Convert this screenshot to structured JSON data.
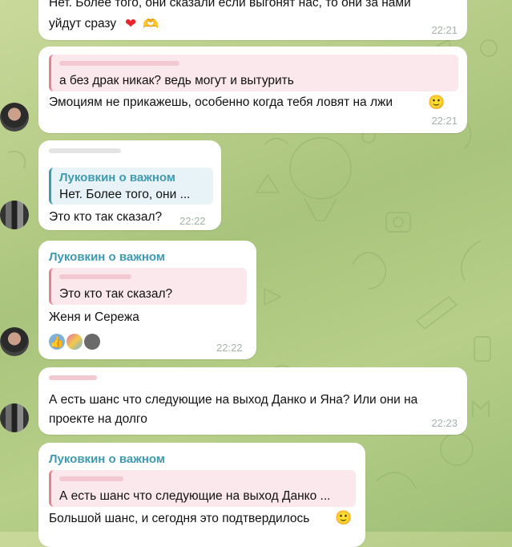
{
  "messages": [
    {
      "text_line1": "Нет. Более того, они сказали если выгонят нас, то они за нами",
      "text_line2": "уйдут сразу",
      "emoji": [
        "heart-icon",
        "heart-hands-icon"
      ],
      "time": "22:21"
    },
    {
      "quote_text": "а без драк никак?  ведь могут и вытурить",
      "text": "Эмоциям не прикажешь, особенно когда тебя ловят на лжи",
      "emoji": "slightly-smiling-face-icon",
      "time": "22:21"
    },
    {
      "quote_name": "Луковкин о важном",
      "quote_text": "Нет. Более того, они ...",
      "text": "Это кто так сказал?",
      "time": "22:22"
    },
    {
      "sender": "Луковкин о важном",
      "quote_text": "Это кто так сказал?",
      "text": "Женя и Сережа",
      "reactions": [
        "thumbs-up-icon",
        "reactor-avatar-icon",
        "reactor-avatar-icon"
      ],
      "time": "22:22"
    },
    {
      "text_line1": "А есть шанс что следующие на выход Данко и Яна? Или они на",
      "text_line2": "проекте на долго",
      "time": "22:23"
    },
    {
      "sender": "Луковкин о важном",
      "quote_text": "А есть шанс что следующие на выход Данко ...",
      "text": "Большой шанс, и сегодня это подтвердилось",
      "emoji": "slightly-smiling-face-icon"
    }
  ],
  "colors": {
    "sender_name": "#3f9ab0",
    "quote_pink": "#e4838f",
    "bubble": "#ffffff",
    "time": "#a3b3a8"
  }
}
